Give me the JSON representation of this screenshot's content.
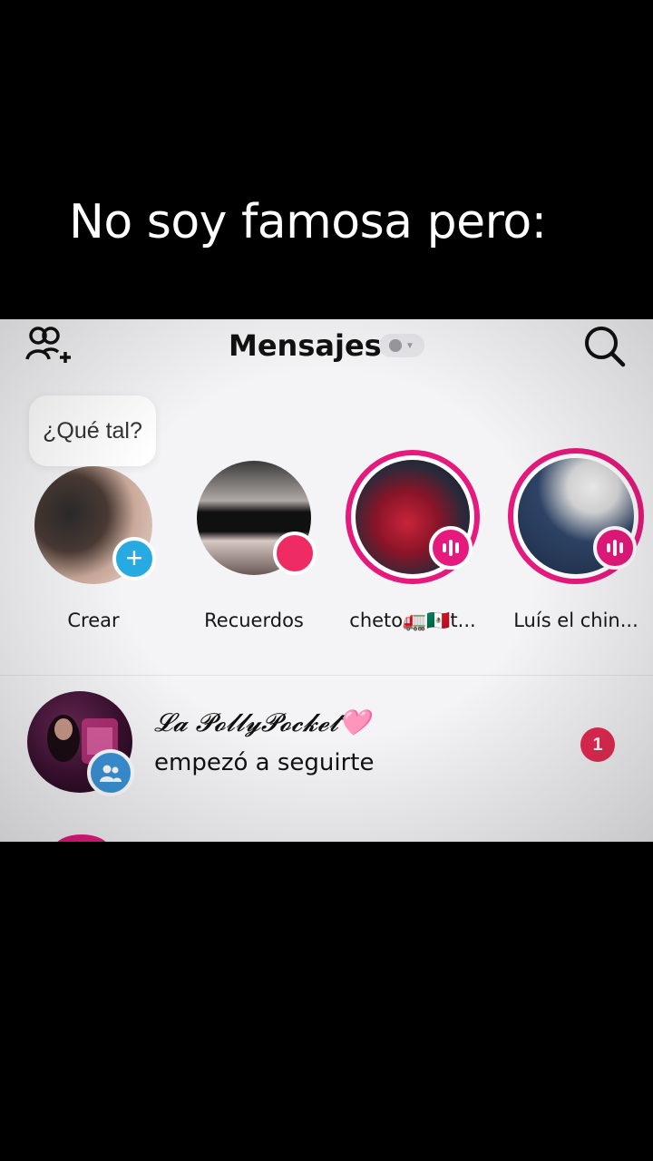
{
  "caption": "No soy famosa pero:",
  "header": {
    "title": "Mensajes",
    "add_friends_icon": "add-friends-icon",
    "search_icon": "search-icon"
  },
  "note_bubble": "¿Qué tal?",
  "stories": [
    {
      "label": "Crear",
      "badge": "plus"
    },
    {
      "label": "Recuerdos",
      "badge": "record"
    },
    {
      "label": "cheto🚛🇲🇽t...",
      "badge": "live"
    },
    {
      "label": "Luís el chin...",
      "badge": "live"
    }
  ],
  "conversations": [
    {
      "name": "𝓛𝓪 𝓟𝓸𝓵𝓵𝔂𝓟𝓸𝓬𝓴𝓮𝓽🩷",
      "message": "empezó a seguirte",
      "unread": "1"
    }
  ],
  "colors": {
    "accent_pink": "#e6197d",
    "create_blue": "#27a9e1",
    "unread_red": "#e62b52"
  }
}
